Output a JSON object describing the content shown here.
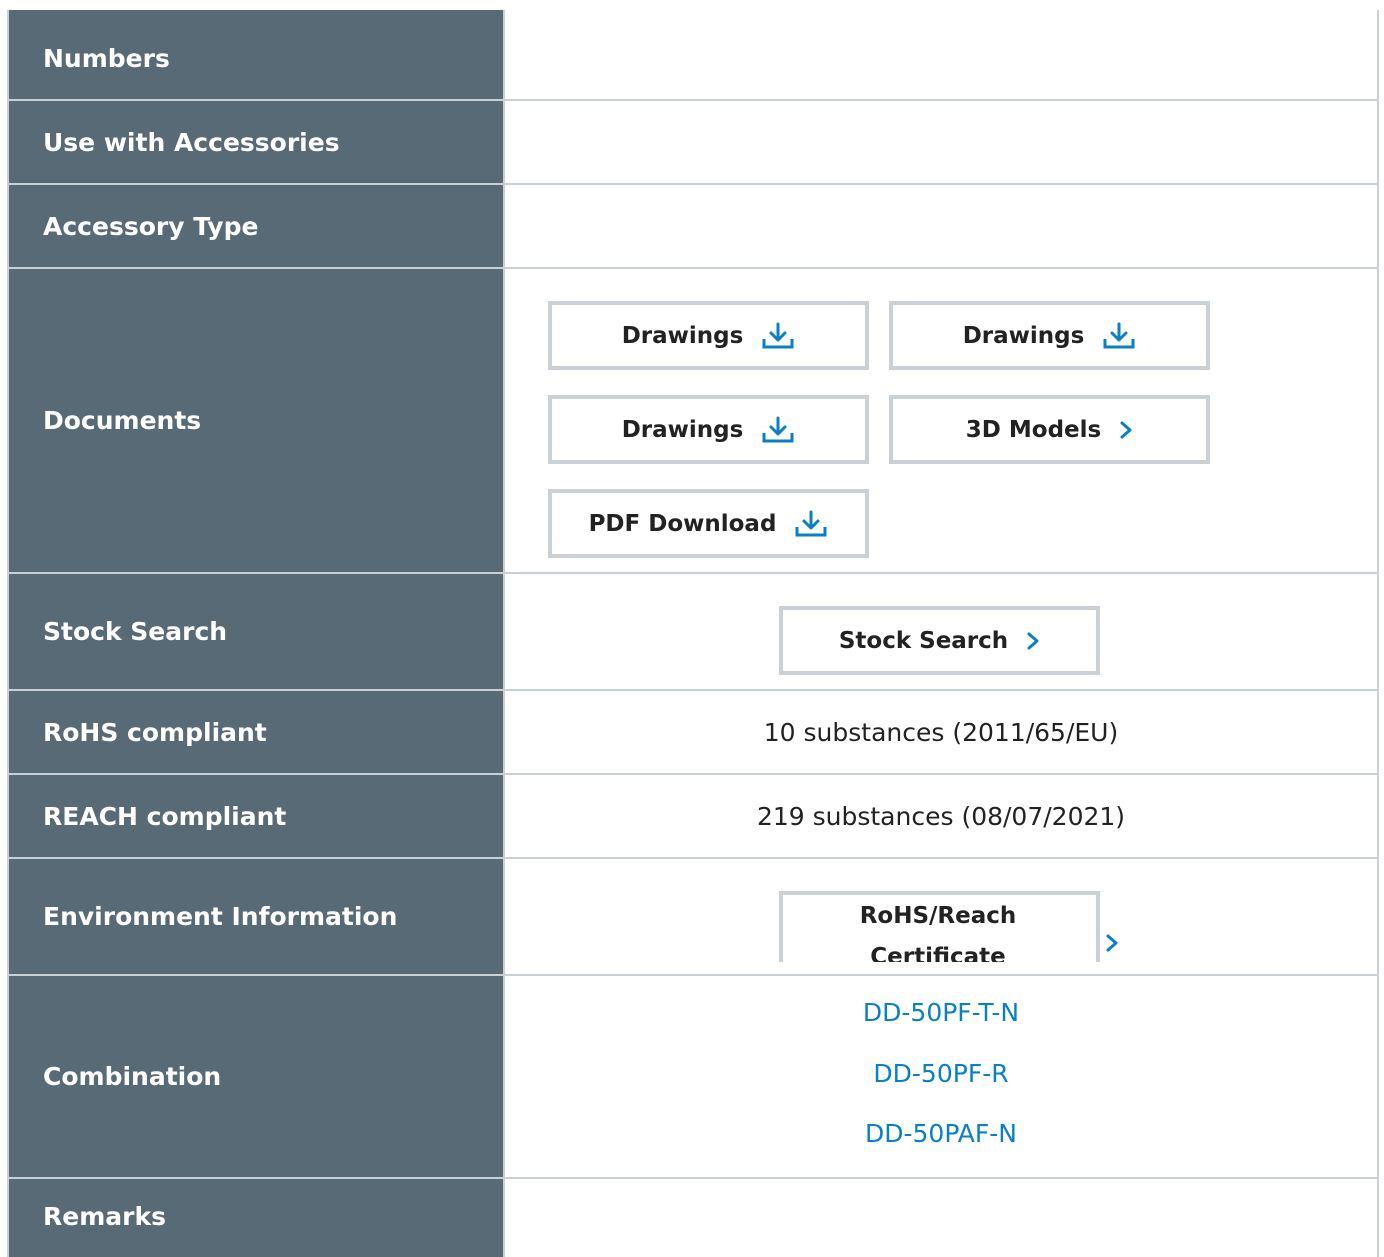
{
  "rows": {
    "partial_top": {
      "label": "Numbers"
    },
    "use_with_accessories": {
      "label": "Use with Accessories"
    },
    "accessory_type": {
      "label": "Accessory Type"
    },
    "documents": {
      "label": "Documents",
      "buttons": [
        {
          "label": "Drawings",
          "icon": "download-icon"
        },
        {
          "label": "Drawings",
          "icon": "download-icon"
        },
        {
          "label": "Drawings",
          "icon": "download-icon"
        },
        {
          "label": "3D Models",
          "icon": "chevron-right-icon"
        },
        {
          "label": "PDF Download",
          "icon": "download-icon"
        }
      ]
    },
    "stock_search": {
      "label": "Stock Search",
      "button": {
        "label": "Stock Search",
        "icon": "chevron-right-icon"
      }
    },
    "rohs": {
      "label": "RoHS compliant",
      "value": "10 substances (2011/65/EU)"
    },
    "reach": {
      "label": "REACH compliant",
      "value": "219 substances (08/07/2021)"
    },
    "environment": {
      "label": "Environment Information",
      "button": {
        "line1": "RoHS/Reach",
        "line2": "Certificate",
        "icon": "chevron-right-icon"
      }
    },
    "combination": {
      "label": "Combination",
      "links": [
        "DD-50PF-T-N",
        "DD-50PF-R",
        "DD-50PAF-N"
      ]
    },
    "remarks": {
      "label": "Remarks"
    }
  },
  "colors": {
    "label_bg": "#586a76",
    "border": "#c9d1d6",
    "accent": "#0a7fc4"
  }
}
